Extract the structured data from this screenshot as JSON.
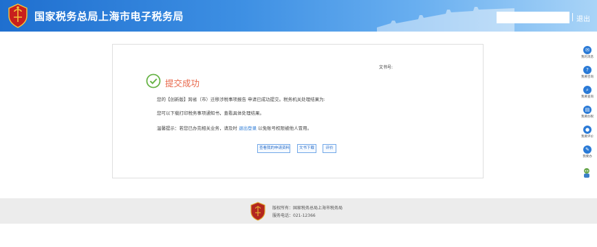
{
  "header": {
    "title": "国家税务总局上海市电子税务局",
    "logout_label": "退出"
  },
  "card": {
    "docno_label": "文书号:",
    "success_title": "提交成功",
    "line1": "您的【创新版】跨省（市）迁移涉税事项报告 申请已成功提交。税务机关处理结果为:",
    "line2": "您可以下载打印税务事项通知书，查看具体处理结果。",
    "line3_prefix": "温馨提示：若您已办完相关业务，请及时",
    "line3_link": "退出登录",
    "line3_suffix": "以免账号权限被他人冒用。",
    "buttons": {
      "view": "查看我的申请资料",
      "download": "文书下载",
      "rate": "评价"
    }
  },
  "sidebar": {
    "items": [
      {
        "label": "我的消息",
        "icon": "message-icon"
      },
      {
        "label": "我要咨询",
        "icon": "consult-icon"
      },
      {
        "label": "我要查询",
        "icon": "search-icon"
      },
      {
        "label": "我要办税",
        "icon": "tax-icon"
      },
      {
        "label": "我要评价",
        "icon": "rate-icon"
      },
      {
        "label": "我要办",
        "icon": "edit-icon"
      }
    ]
  },
  "footer": {
    "copyright": "版权所有：国家税务总局上海市税务局",
    "hotline": "服务电话：021-12366"
  },
  "colors": {
    "header_blue": "#1f6fcf",
    "success_green": "#67b346",
    "success_title": "#e8674a",
    "link_blue": "#2a7ad6"
  }
}
